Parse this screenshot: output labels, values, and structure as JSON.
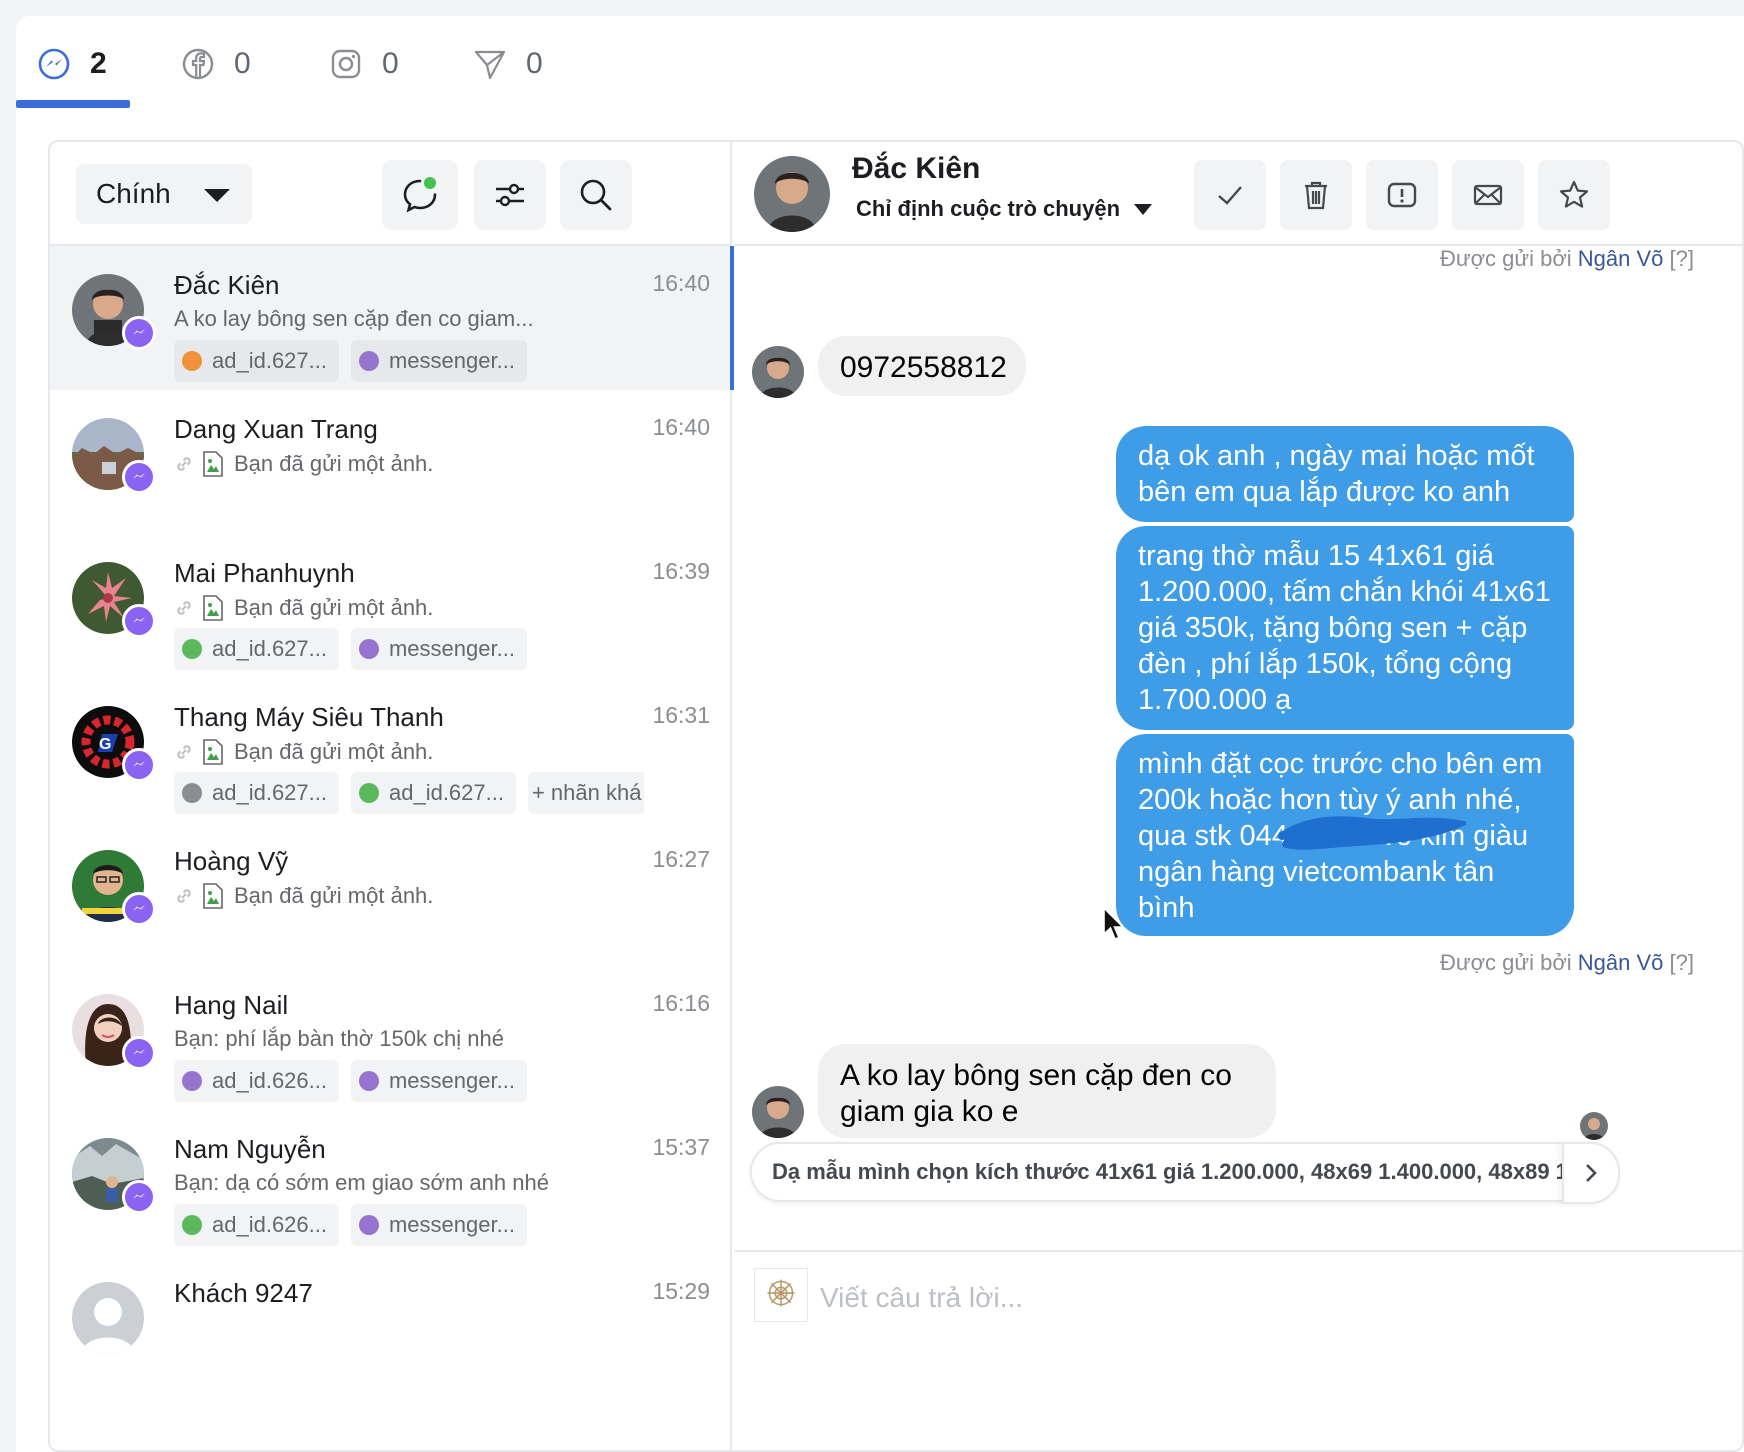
{
  "platform_tabs": [
    {
      "name": "messenger",
      "count": "2",
      "active": true
    },
    {
      "name": "facebook",
      "count": "0",
      "active": false
    },
    {
      "name": "instagram",
      "count": "0",
      "active": false
    },
    {
      "name": "direct",
      "count": "0",
      "active": false
    }
  ],
  "inbox": {
    "folder": "Chính",
    "conversations": [
      {
        "name": "Đắc Kiên",
        "time": "16:40",
        "snippet": "A ko lay bông sen cặp đen co giam...",
        "has_attachment": false,
        "tags": [
          {
            "label": "ad_id.627...",
            "color": "#f0913a"
          },
          {
            "label": "messenger...",
            "color": "#9575cd"
          }
        ]
      },
      {
        "name": "Dang Xuan Trang",
        "time": "16:40",
        "snippet": "Bạn đã gửi một ảnh.",
        "has_attachment": true,
        "tags": []
      },
      {
        "name": "Mai Phanhuynh",
        "time": "16:39",
        "snippet": "Bạn đã gửi một ảnh.",
        "has_attachment": true,
        "tags": [
          {
            "label": "ad_id.627...",
            "color": "#5cb85c"
          },
          {
            "label": "messenger...",
            "color": "#9575cd"
          }
        ]
      },
      {
        "name": "Thang Máy Siêu Thanh",
        "time": "16:31",
        "snippet": "Bạn đã gửi một ảnh.",
        "has_attachment": true,
        "tags": [
          {
            "label": "ad_id.627...",
            "color": "#8a8d91"
          },
          {
            "label": "ad_id.627...",
            "color": "#5cb85c"
          }
        ],
        "more_tags": "+ nhãn khá"
      },
      {
        "name": "Hoàng Vỹ",
        "time": "16:27",
        "snippet": "Bạn đã gửi một ảnh.",
        "has_attachment": true,
        "tags": []
      },
      {
        "name": "Hang Nail",
        "time": "16:16",
        "snippet": "Bạn: phí lắp bàn thờ 150k chị nhé",
        "has_attachment": false,
        "tags": [
          {
            "label": "ad_id.626...",
            "color": "#9575cd"
          },
          {
            "label": "messenger...",
            "color": "#9575cd"
          }
        ]
      },
      {
        "name": "Nam Nguyễn",
        "time": "15:37",
        "snippet": "Bạn: dạ có sớm em giao sớm anh nhé",
        "has_attachment": false,
        "tags": [
          {
            "label": "ad_id.626...",
            "color": "#5cb85c"
          },
          {
            "label": "messenger...",
            "color": "#9575cd"
          }
        ]
      },
      {
        "name": "Khách 9247",
        "time": "15:29",
        "snippet": "",
        "has_attachment": false,
        "tags": []
      }
    ]
  },
  "chat": {
    "contact_name": "Đắc Kiên",
    "assign_label": "Chỉ định cuộc trò chuyện",
    "sent_by_prefix": "Được gửi bởi",
    "sent_by_name": "Ngân Võ",
    "sent_by_help": "[?]",
    "messages": [
      {
        "dir": "in",
        "text": "0972558812"
      },
      {
        "dir": "out",
        "text": "dạ ok anh , ngày mai hoặc mốt bên em qua lắp được ko anh"
      },
      {
        "dir": "out",
        "text": "trang thờ mẫu 15 41x61 giá 1.200.000, tấm chắn khói 41x61 giá 350k, tặng bông sen + cặp đèn , phí lắp 150k, tổng cộng 1.700.000 ạ"
      },
      {
        "dir": "out",
        "text": "mình đặt cọc trước cho bên em 200k hoặc hơn tùy ý anh nhé, qua stk 044 chủ tk võ kim giàu ngân hàng vietcombank tân bình"
      },
      {
        "dir": "in",
        "text": "A ko lay bông sen cặp đen co giam gia ko e"
      }
    ],
    "suggested_reply": "Dạ mẫu mình chọn kích thước 41x61 giá 1.200.000, 48x69 1.400.000, 48x89 1",
    "composer_placeholder": "Viết câu trả lời..."
  },
  "colors": {
    "accent": "#3b6fd8",
    "outgoing_bubble": "#3f9de8",
    "messenger_badge": "#8a63f2"
  }
}
